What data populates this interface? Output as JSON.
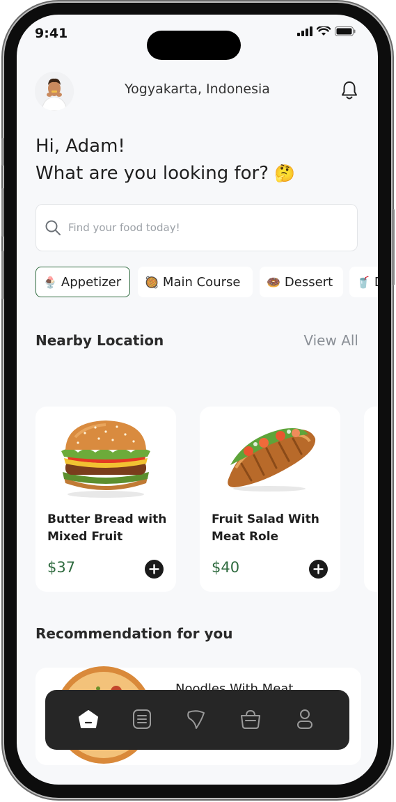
{
  "status_bar": {
    "time": "9:41"
  },
  "header": {
    "location": "Yogyakarta, Indonesia"
  },
  "greeting": {
    "hello": "Hi, Adam!",
    "question": "What are you looking for?",
    "emoji": "🤔"
  },
  "search": {
    "placeholder": "Find your food today!"
  },
  "categories": [
    {
      "label": "Appetizer",
      "icon": "🍨",
      "active": true
    },
    {
      "label": "Main Course",
      "icon": "🥘",
      "active": false
    },
    {
      "label": "Dessert",
      "icon": "🍩",
      "active": false
    },
    {
      "label": "D",
      "icon": "🥤",
      "active": false
    }
  ],
  "nearby": {
    "title": "Nearby Location",
    "view_all": "View All",
    "items": [
      {
        "name": "Butter Bread with Mixed Fruit",
        "price": "$37",
        "image": "burger"
      },
      {
        "name": "Fruit Salad With Meat Role",
        "price": "$40",
        "image": "croissant-sandwich"
      }
    ]
  },
  "recommendation": {
    "title": "Recommendation for you",
    "items": [
      {
        "name": "Noodles With Meat",
        "image": "pizza"
      }
    ]
  },
  "nav": {
    "items": [
      "home-icon",
      "menu-list-icon",
      "map-pin-icon",
      "basket-icon",
      "profile-icon"
    ],
    "active": "home-icon"
  },
  "colors": {
    "accent": "#2f6b3f",
    "nav_bg": "#262626",
    "screen_bg": "#f7f8fa"
  }
}
